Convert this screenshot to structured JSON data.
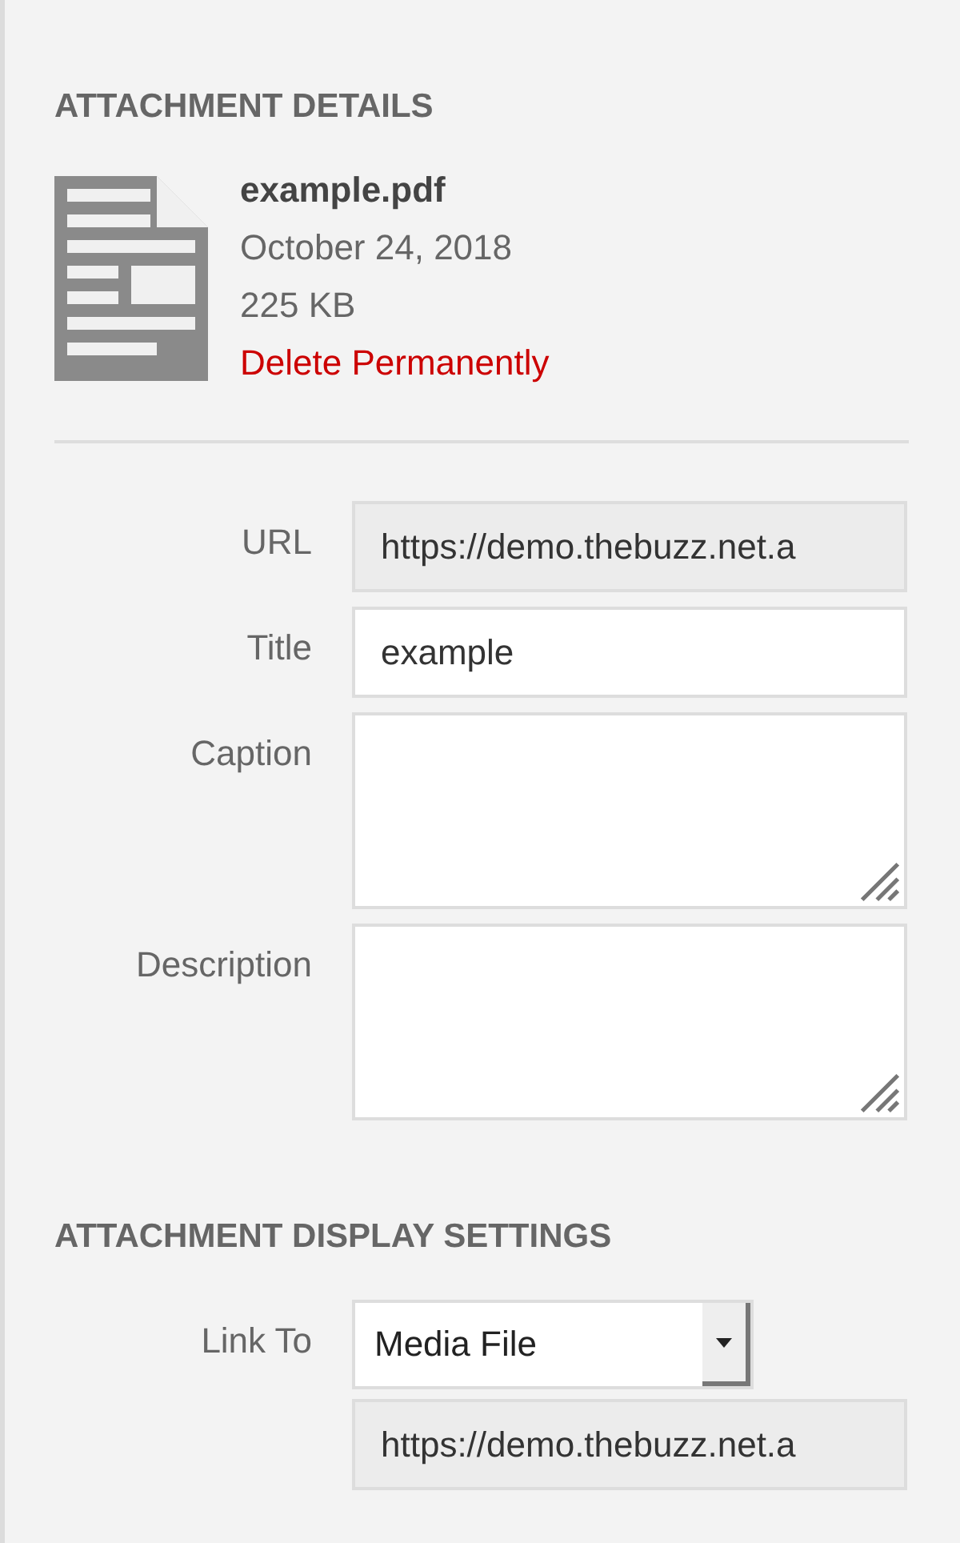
{
  "details": {
    "heading": "ATTACHMENT DETAILS",
    "filename": "example.pdf",
    "date": "October 24, 2018",
    "size": "225 KB",
    "delete_link": "Delete Permanently"
  },
  "fields": [
    {
      "label": "URL",
      "kind": "input",
      "value": "https://demo.thebuzz.net.a",
      "readonly": true
    },
    {
      "label": "Title",
      "kind": "input",
      "value": "example",
      "readonly": false
    },
    {
      "label": "Caption",
      "kind": "textarea",
      "readonly": false
    },
    {
      "label": "Description",
      "kind": "textarea",
      "readonly": false
    }
  ],
  "display_settings": {
    "heading": "ATTACHMENT DISPLAY SETTINGS",
    "link_to": {
      "label": "Link To",
      "value": "Media File"
    },
    "link_url": {
      "value": "https://demo.thebuzz.net.a",
      "readonly": true
    }
  }
}
